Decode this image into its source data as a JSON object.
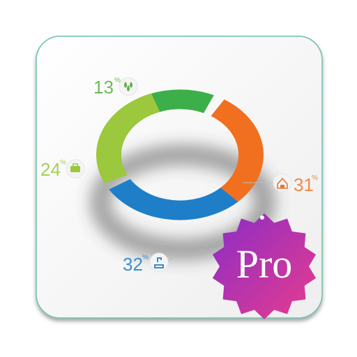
{
  "colors": {
    "green": "#3daf4a",
    "orange": "#f07020",
    "blue": "#1e7ec8",
    "lime": "#9bc83c",
    "badge_start": "#8a2cc8",
    "badge_end": "#e83c8c"
  },
  "segments": [
    {
      "label": "13",
      "unit": "%",
      "value": 13,
      "color": "#3daf4a",
      "icon": "drops-icon"
    },
    {
      "label": "31",
      "unit": "%",
      "value": 31,
      "color": "#f07020",
      "icon": "house-icon"
    },
    {
      "label": "32",
      "unit": "%",
      "value": 32,
      "color": "#1e7ec8",
      "icon": "tap-icon"
    },
    {
      "label": "24",
      "unit": "%",
      "value": 24,
      "color": "#9bc83c",
      "icon": "briefcase-icon"
    }
  ],
  "badge": {
    "text": "Pro"
  }
}
